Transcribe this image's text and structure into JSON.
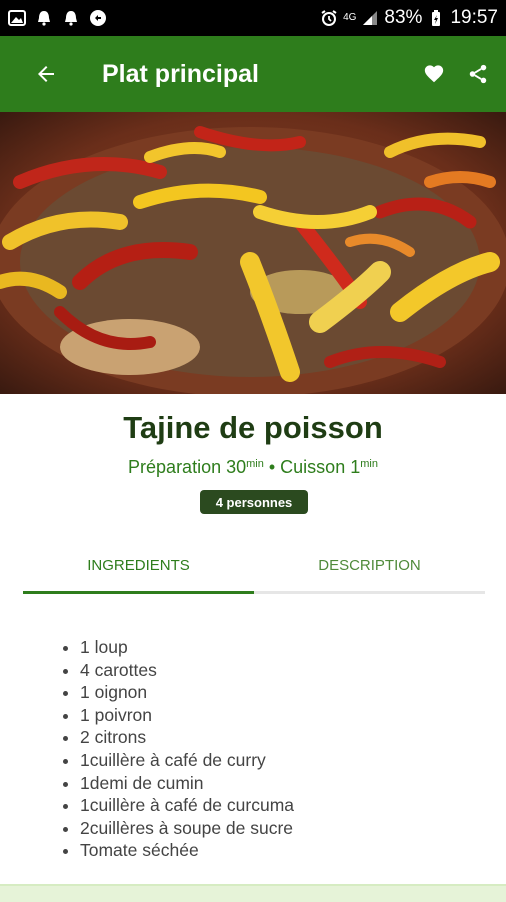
{
  "status_bar": {
    "network": "4G",
    "battery": "83%",
    "time": "19:57"
  },
  "app_bar": {
    "title": "Plat principal"
  },
  "recipe": {
    "title": "Tajine de poisson",
    "prep_label": "Préparation 30",
    "prep_unit": "min",
    "separator": " • ",
    "cook_label": "Cuisson 1",
    "cook_unit": "min",
    "servings": "4 personnes"
  },
  "tabs": [
    {
      "label": "INGREDIENTS",
      "active": true
    },
    {
      "label": "DESCRIPTION",
      "active": false
    }
  ],
  "ingredients": [
    "1 loup",
    "4 carottes",
    "1 oignon",
    "1 poivron",
    "2 citrons",
    "1cuillère à café de curry",
    "1demi de cumin",
    "1cuillère à café de curcuma",
    "2cuillères à soupe de sucre",
    "Tomate séchée"
  ],
  "colors": {
    "primary": "#2e7d1c",
    "dark_green": "#1f3d14",
    "badge": "#2b4a1f"
  },
  "icons": {
    "back": "arrow-left-icon",
    "favorite": "heart-icon",
    "share": "share-icon"
  }
}
